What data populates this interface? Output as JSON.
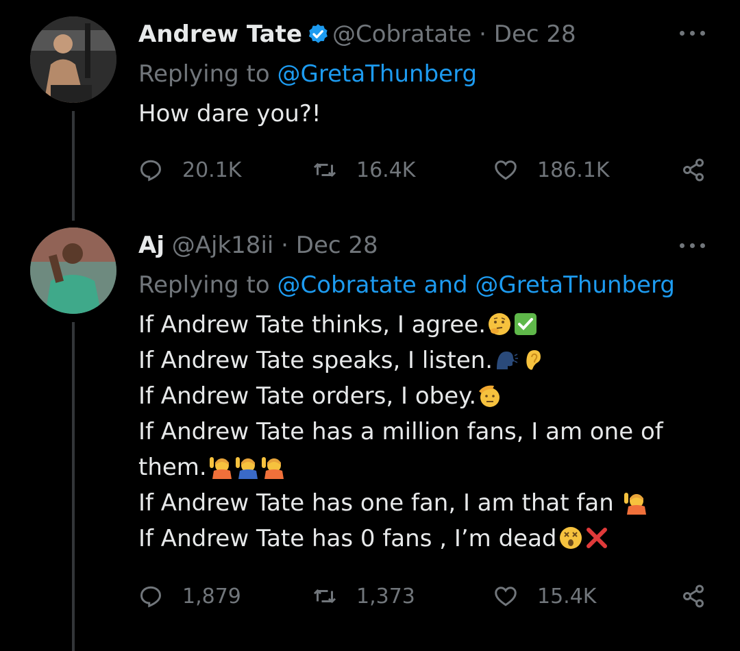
{
  "tweets": [
    {
      "name": "Andrew Tate",
      "verified": true,
      "handle": "@Cobratate",
      "separator": "·",
      "date": "Dec 28",
      "replying_prefix": "Replying to",
      "replying_to": "@GretaThunberg",
      "text_lines": [
        "How dare you?!"
      ],
      "stats": {
        "replies": "20.1K",
        "retweets": "16.4K",
        "likes": "186.1K"
      }
    },
    {
      "name": "Aj",
      "verified": false,
      "handle": "@Ajk18ii",
      "separator": "·",
      "date": "Dec 28",
      "replying_prefix": "Replying to",
      "replying_to": "@Cobratate and @GretaThunberg",
      "text_lines": [
        "If Andrew Tate thinks, I agree.",
        "If Andrew Tate speaks, I listen.",
        "If Andrew Tate orders, I obey.",
        "If Andrew Tate has a million fans, I am one of",
        "them.",
        "If Andrew Tate has one fan, I am that fan",
        "If Andrew Tate has 0 fans , I’m dead"
      ],
      "stats": {
        "replies": "1,879",
        "retweets": "1,373",
        "likes": "15.4K"
      }
    }
  ],
  "colors": {
    "background": "#000000",
    "text": "#e7e9ea",
    "muted": "#71767b",
    "accent": "#1d9bf0"
  },
  "icons": [
    "verified-badge-icon",
    "more-icon",
    "reply-icon",
    "retweet-icon",
    "like-icon",
    "share-icon"
  ]
}
